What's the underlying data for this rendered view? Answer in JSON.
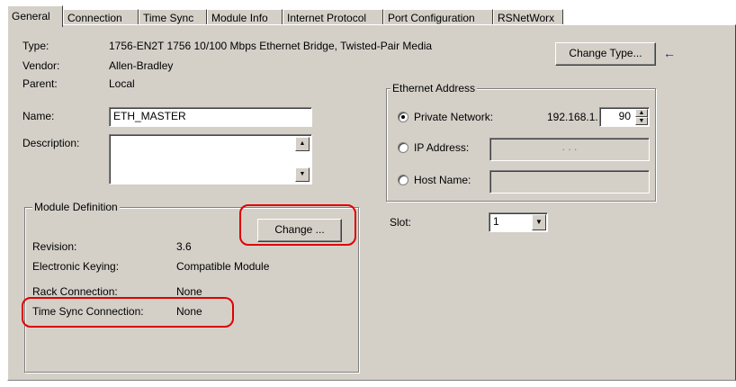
{
  "tabs": [
    {
      "label": "General",
      "active": true
    },
    {
      "label": "Connection"
    },
    {
      "label": "Time Sync"
    },
    {
      "label": "Module Info"
    },
    {
      "label": "Internet Protocol"
    },
    {
      "label": "Port Configuration"
    },
    {
      "label": "RSNetWorx"
    }
  ],
  "general": {
    "type_label": "Type:",
    "type_value": "1756-EN2T 1756 10/100 Mbps Ethernet Bridge, Twisted-Pair Media",
    "vendor_label": "Vendor:",
    "vendor_value": "Allen-Bradley",
    "parent_label": "Parent:",
    "parent_value": "Local",
    "name_label": "Name:",
    "name_value": "ETH_MASTER",
    "description_label": "Description:",
    "description_value": "",
    "change_type_label": "Change Type...",
    "arrow_icon": "left-arrow-icon",
    "arrow_color": "#1a1aa0"
  },
  "ethernet": {
    "title": "Ethernet Address",
    "private_label": "Private Network:",
    "private_prefix": "192.168.1.",
    "private_octet": "90",
    "ip_label": "IP Address:",
    "ip_dots": ".        .        .",
    "host_label": "Host Name:",
    "host_value": "",
    "selected": "private"
  },
  "slot": {
    "label": "Slot:",
    "value": "1"
  },
  "module_def": {
    "title": "Module Definition",
    "change_label": "Change ...",
    "revision_label": "Revision:",
    "revision_value": "3.6",
    "keying_label": "Electronic Keying:",
    "keying_value": "Compatible Module",
    "rack_label": "Rack Connection:",
    "rack_value": "None",
    "timesync_label": "Time Sync Connection:",
    "timesync_value": "None"
  },
  "highlight_color": "#e00000"
}
